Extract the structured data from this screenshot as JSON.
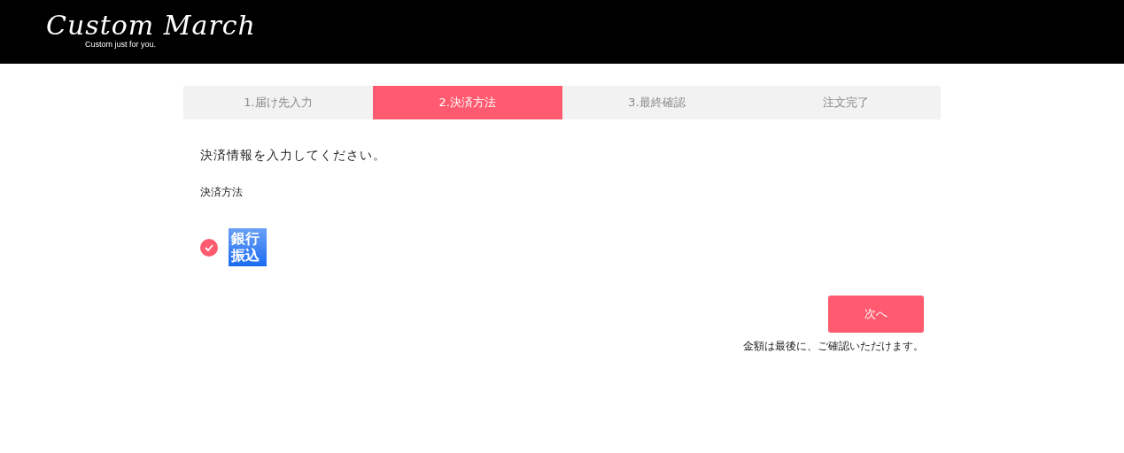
{
  "header": {
    "logo": "Custom March",
    "tagline": "Custom just for you."
  },
  "steps": [
    {
      "label": "1.届け先入力",
      "selected": false
    },
    {
      "label": "2.決済方法",
      "selected": true
    },
    {
      "label": "3.最終確認",
      "selected": false
    },
    {
      "label": "注文完了",
      "selected": false
    }
  ],
  "instruction": "決済情報を入力してください。",
  "section_label": "決済方法",
  "payment_methods": [
    {
      "label": "銀行振込",
      "selected": true
    }
  ],
  "next_button": "次へ",
  "note": "金額は最後に、ご確認いただけます。"
}
